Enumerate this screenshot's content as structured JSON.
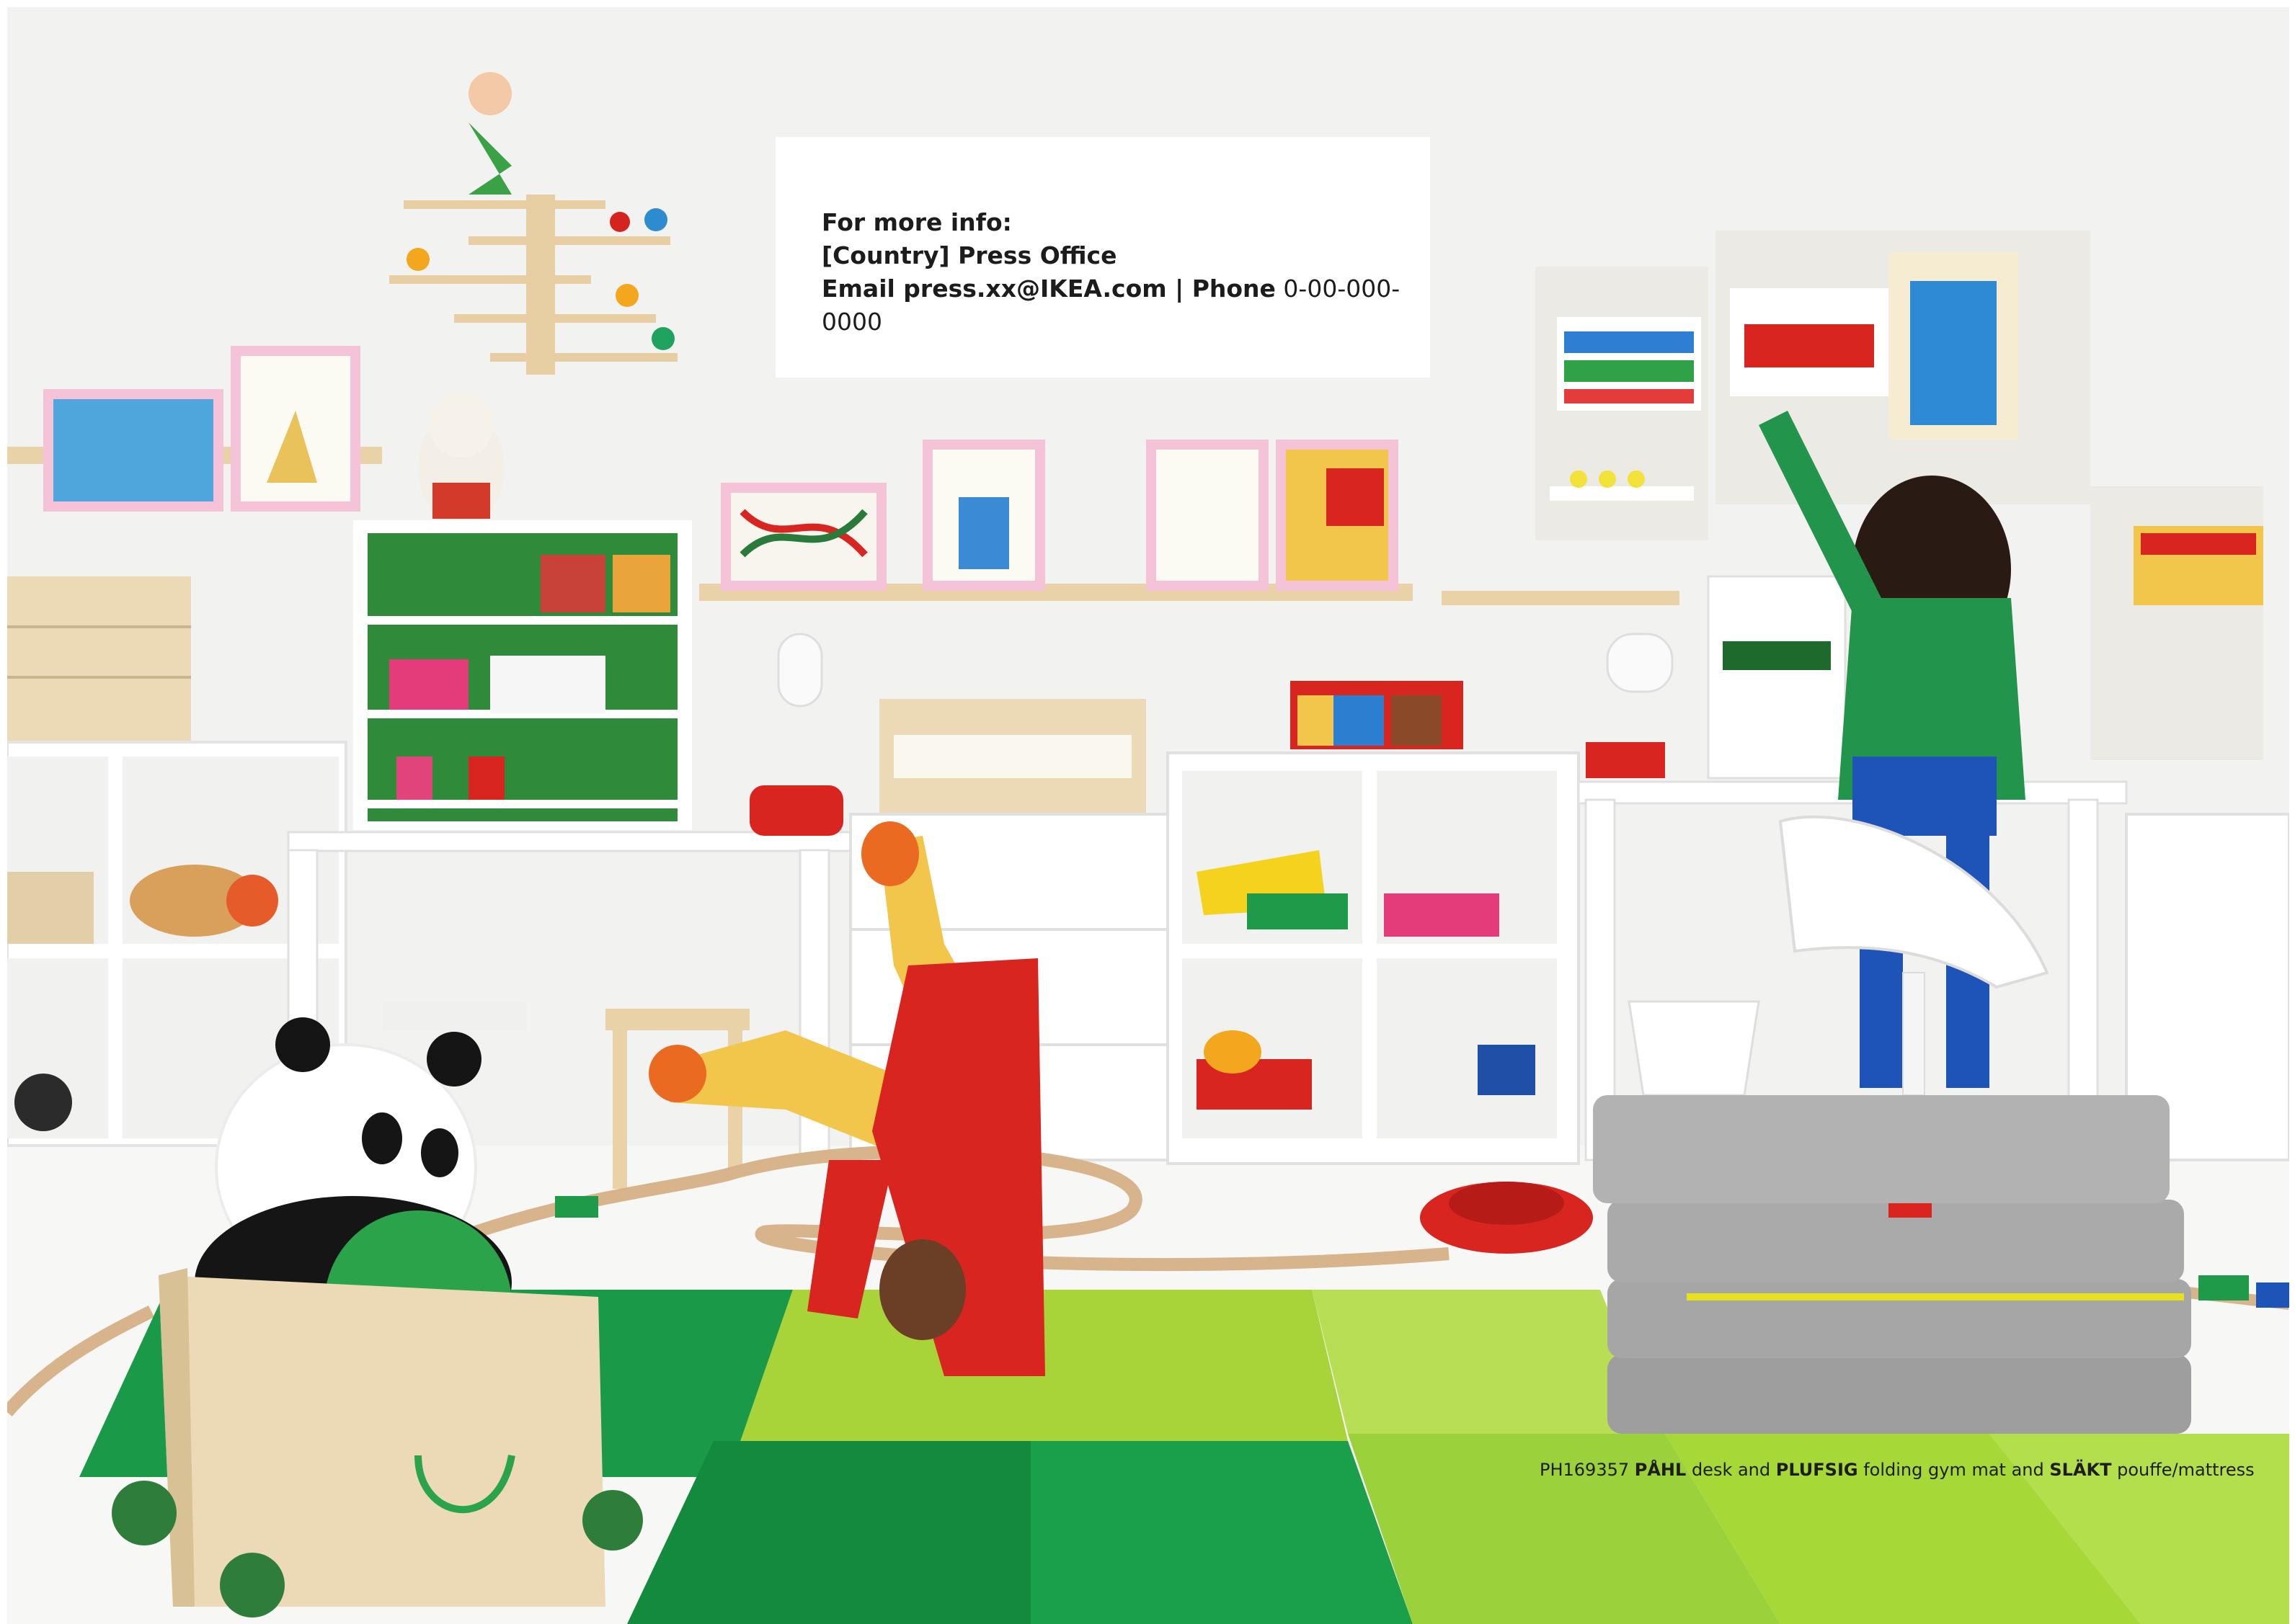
{
  "info_box": {
    "line1": "For more info:",
    "line2": "[Country] Press Office",
    "line3_label": "Email press.xx@IKEA.com | Phone",
    "line3_value": " 0-00-000-0000"
  },
  "caption": {
    "code": "PH169357 ",
    "product1": "PÅHL",
    "text1": " desk and ",
    "product2": "PLUFSIG",
    "text2": " folding gym mat and ",
    "product3": "SLÄKT",
    "text3": " pouffe/mattress"
  },
  "colors": {
    "wall": "#f3f3f1",
    "floor": "#f7f7f5",
    "mat_dark_green": "#1a9a48",
    "mat_light_green": "#a8d43a",
    "shelf_green": "#2e8a3c",
    "sweater_green": "#21934b",
    "red_outfit": "#d8251f",
    "yellow_pants": "#f2c64a",
    "pouffe_grey": "#a8a8a8",
    "wood": "#e9d2a8"
  }
}
